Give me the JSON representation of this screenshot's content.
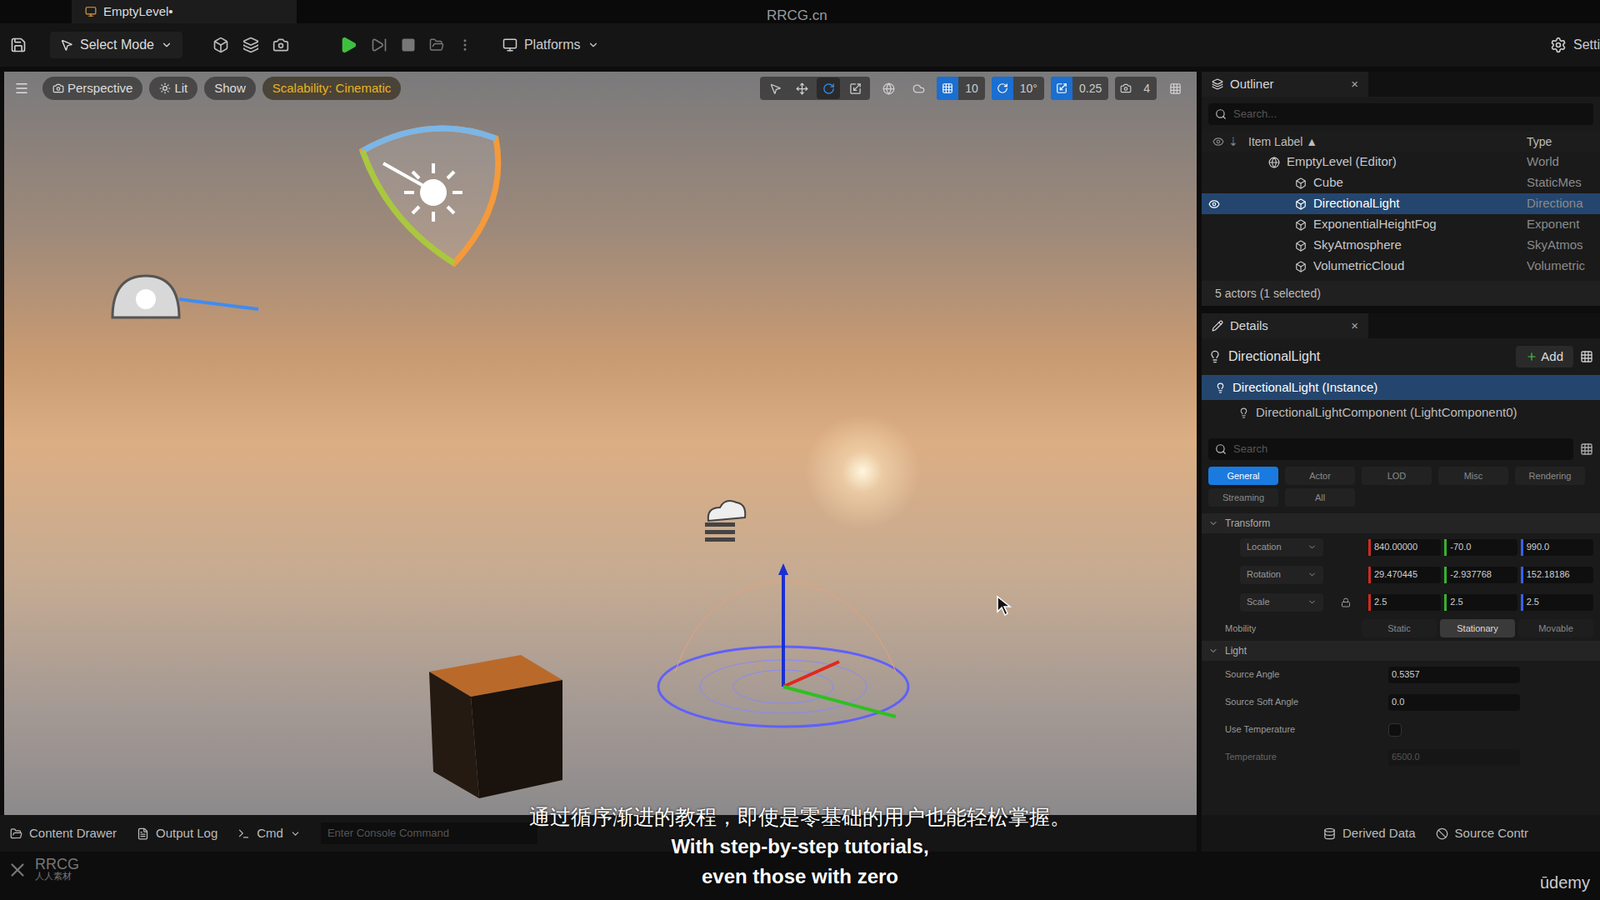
{
  "window": {
    "title": "EmptyLevel•",
    "site": "RRCG.cn"
  },
  "toolbar": {
    "mode": "Select Mode",
    "platforms": "Platforms",
    "settings": "Setti"
  },
  "viewport": {
    "buttons": [
      {
        "label": "Perspective",
        "kind": "normal"
      },
      {
        "label": "Lit",
        "kind": "normal"
      },
      {
        "label": "Show",
        "kind": "normal"
      },
      {
        "label": "Scalability: Cinematic",
        "kind": "warning"
      }
    ],
    "snaps": [
      {
        "value": "10",
        "active": true
      },
      {
        "value": "10°",
        "active": true
      },
      {
        "value": "0.25",
        "active": true
      },
      {
        "value": "4",
        "active": false
      }
    ]
  },
  "outliner": {
    "title": "Outliner",
    "close": "×",
    "search": "Search...",
    "columns": [
      "Item Label ▲",
      "Type"
    ],
    "rows": [
      {
        "label": "EmptyLevel (Editor)",
        "type": "World",
        "kind": "world",
        "selected": false,
        "eye": false
      },
      {
        "label": "Cube",
        "type": "StaticMes",
        "kind": "actor",
        "selected": false,
        "eye": false
      },
      {
        "label": "DirectionalLight",
        "type": "Directiona",
        "kind": "actor",
        "selected": true,
        "eye": true
      },
      {
        "label": "ExponentialHeightFog",
        "type": "Exponent",
        "kind": "actor",
        "selected": false,
        "eye": false
      },
      {
        "label": "SkyAtmosphere",
        "type": "SkyAtmos",
        "kind": "actor",
        "selected": false,
        "eye": false
      },
      {
        "label": "VolumetricCloud",
        "type": "Volumetric",
        "kind": "actor",
        "selected": false,
        "eye": false
      }
    ],
    "footer": "5 actors (1 selected)"
  },
  "details": {
    "title": "Details",
    "close": "×",
    "actor": "DirectionalLight",
    "add": "Add",
    "components": [
      {
        "label": "DirectionalLight (Instance)",
        "selected": true
      },
      {
        "label": "DirectionalLightComponent (LightComponent0)",
        "selected": false
      }
    ],
    "search": "Search",
    "filters": [
      {
        "label": "General",
        "selected": true
      },
      {
        "label": "Actor",
        "selected": false
      },
      {
        "label": "LOD",
        "selected": false
      },
      {
        "label": "Misc",
        "selected": false
      },
      {
        "label": "Rendering",
        "selected": false
      },
      {
        "label": "Streaming",
        "selected": false
      },
      {
        "label": "All",
        "selected": false
      }
    ],
    "transform": {
      "title": "Transform",
      "rows": [
        {
          "label": "Location",
          "values": [
            "840.00000",
            "-70.0",
            "990.0"
          ]
        },
        {
          "label": "Rotation",
          "values": [
            "29.470445",
            "-2.937768",
            "152.18186"
          ]
        },
        {
          "label": "Scale",
          "values": [
            "2.5",
            "2.5",
            "2.5"
          ]
        }
      ],
      "mobility": {
        "label": "Mobility",
        "options": [
          {
            "label": "Static",
            "selected": false
          },
          {
            "label": "Stationary",
            "selected": true
          },
          {
            "label": "Movable",
            "selected": false
          }
        ]
      }
    },
    "light": {
      "title": "Light",
      "rows": [
        {
          "label": "Source Angle",
          "kind": "number",
          "value": "0.5357",
          "disabled": false
        },
        {
          "label": "Source Soft Angle",
          "kind": "number",
          "value": "0.0",
          "disabled": false
        },
        {
          "label": "Use Temperature",
          "kind": "checkbox",
          "checked": false,
          "disabled": false
        },
        {
          "label": "Temperature",
          "kind": "number",
          "value": "6500.0",
          "disabled": true
        }
      ]
    }
  },
  "statusbar": {
    "items": [
      "Content Drawer",
      "Output Log"
    ],
    "cmd": "Cmd",
    "console": "Enter Console Command",
    "right": [
      "Derived Data",
      "Source Contr"
    ]
  },
  "subtitles": [
    "通过循序渐进的教程，即使是零基础的用户也能轻松掌握。",
    "With step-by-step tutorials,",
    "even those with zero"
  ],
  "watermark": {
    "logo": "RRCG",
    "sub": "人人素材",
    "brand": "ūdemy"
  }
}
